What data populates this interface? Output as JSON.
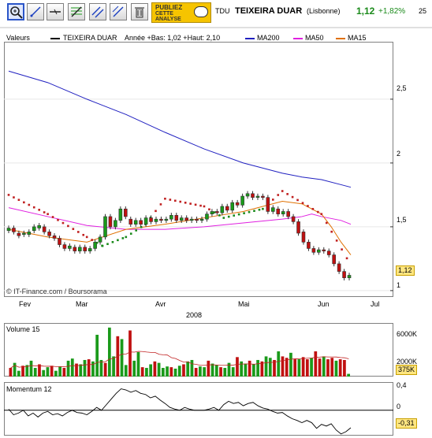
{
  "toolbar": {
    "tools": [
      "zoom-icon",
      "trendline-icon",
      "horizontal-line-icon",
      "fibonacci-icon",
      "channel-icon",
      "parallel-lines-icon",
      "trash-icon"
    ],
    "ad_line1": "PUBLIEZ",
    "ad_line2": "CETTE",
    "ad_line3": "ANALYSE",
    "symbol": "TDU",
    "name": "TEIXEIRA DUAR",
    "market": "(Lisbonne)",
    "price": "1,12",
    "change": "+1,82%",
    "count": "25",
    "price_color": "#1a8a1a"
  },
  "legend": {
    "label": "Valeurs",
    "series_name": "TEIXEIRA DUAR",
    "range_text": "Année +Bas: 1,02 +Haut: 2,10",
    "ma200": "MA200",
    "ma50": "MA50",
    "ma15": "MA15",
    "colors": {
      "ma200": "#2020c0",
      "ma50": "#e020e0",
      "ma15": "#e07000",
      "up": "#1a9a1a",
      "down": "#c01010",
      "sar_up": "#1a8a1a",
      "sar_down": "#c02020"
    }
  },
  "watermark": "© IT-Finance.com / Boursorama",
  "current_tag": "1,12",
  "x_axis": {
    "months": [
      "Fev",
      "Mar",
      "Avr",
      "Mai",
      "Jun",
      "Jul"
    ],
    "year": "2008"
  },
  "price_axis": {
    "ticks": [
      "2,5",
      "2",
      "1,5",
      "1"
    ]
  },
  "volume": {
    "label": "Volume 15",
    "ticks": [
      "6000K",
      "2000K"
    ],
    "tag": "375K"
  },
  "momentum": {
    "label": "Momentum 12",
    "ticks": [
      "0,4",
      "0"
    ],
    "tag": "-0,31"
  },
  "chart_data": [
    {
      "type": "candlestick",
      "title": "TEIXEIRA DUAR",
      "ylim": [
        0.95,
        2.95
      ],
      "x_range_days": [
        0,
        140
      ],
      "candles": [
        {
          "d": 0,
          "o": 1.47,
          "c": 1.49
        },
        {
          "d": 2,
          "o": 1.49,
          "c": 1.46
        },
        {
          "d": 4,
          "o": 1.45,
          "c": 1.43
        },
        {
          "d": 6,
          "o": 1.44,
          "c": 1.45
        },
        {
          "d": 8,
          "o": 1.44,
          "c": 1.46
        },
        {
          "d": 10,
          "o": 1.47,
          "c": 1.5
        },
        {
          "d": 12,
          "o": 1.49,
          "c": 1.51
        },
        {
          "d": 14,
          "o": 1.5,
          "c": 1.46
        },
        {
          "d": 16,
          "o": 1.46,
          "c": 1.43
        },
        {
          "d": 18,
          "o": 1.43,
          "c": 1.41
        },
        {
          "d": 20,
          "o": 1.41,
          "c": 1.36
        },
        {
          "d": 22,
          "o": 1.36,
          "c": 1.33
        },
        {
          "d": 24,
          "o": 1.33,
          "c": 1.35
        },
        {
          "d": 26,
          "o": 1.34,
          "c": 1.31
        },
        {
          "d": 28,
          "o": 1.31,
          "c": 1.34
        },
        {
          "d": 30,
          "o": 1.34,
          "c": 1.31
        },
        {
          "d": 32,
          "o": 1.31,
          "c": 1.33
        },
        {
          "d": 34,
          "o": 1.33,
          "c": 1.38
        },
        {
          "d": 36,
          "o": 1.38,
          "c": 1.42
        },
        {
          "d": 38,
          "o": 1.42,
          "c": 1.58
        },
        {
          "d": 40,
          "o": 1.58,
          "c": 1.5
        },
        {
          "d": 42,
          "o": 1.5,
          "c": 1.55
        },
        {
          "d": 44,
          "o": 1.55,
          "c": 1.64
        },
        {
          "d": 46,
          "o": 1.64,
          "c": 1.58
        },
        {
          "d": 48,
          "o": 1.56,
          "c": 1.52
        },
        {
          "d": 50,
          "o": 1.52,
          "c": 1.55
        },
        {
          "d": 52,
          "o": 1.55,
          "c": 1.52
        },
        {
          "d": 54,
          "o": 1.52,
          "c": 1.57
        },
        {
          "d": 56,
          "o": 1.57,
          "c": 1.54
        },
        {
          "d": 58,
          "o": 1.54,
          "c": 1.56
        },
        {
          "d": 60,
          "o": 1.56,
          "c": 1.55
        },
        {
          "d": 62,
          "o": 1.55,
          "c": 1.56
        },
        {
          "d": 64,
          "o": 1.56,
          "c": 1.59
        },
        {
          "d": 66,
          "o": 1.59,
          "c": 1.55
        },
        {
          "d": 68,
          "o": 1.55,
          "c": 1.57
        },
        {
          "d": 70,
          "o": 1.57,
          "c": 1.55
        },
        {
          "d": 72,
          "o": 1.55,
          "c": 1.56
        },
        {
          "d": 74,
          "o": 1.56,
          "c": 1.55
        },
        {
          "d": 76,
          "o": 1.55,
          "c": 1.56
        },
        {
          "d": 78,
          "o": 1.56,
          "c": 1.6
        },
        {
          "d": 80,
          "o": 1.6,
          "c": 1.62
        },
        {
          "d": 82,
          "o": 1.62,
          "c": 1.61
        },
        {
          "d": 84,
          "o": 1.61,
          "c": 1.66
        },
        {
          "d": 86,
          "o": 1.66,
          "c": 1.63
        },
        {
          "d": 88,
          "o": 1.63,
          "c": 1.69
        },
        {
          "d": 90,
          "o": 1.69,
          "c": 1.67
        },
        {
          "d": 92,
          "o": 1.67,
          "c": 1.74
        },
        {
          "d": 94,
          "o": 1.74,
          "c": 1.76
        },
        {
          "d": 96,
          "o": 1.76,
          "c": 1.73
        },
        {
          "d": 98,
          "o": 1.73,
          "c": 1.74
        },
        {
          "d": 100,
          "o": 1.74,
          "c": 1.73
        },
        {
          "d": 102,
          "o": 1.73,
          "c": 1.62
        },
        {
          "d": 104,
          "o": 1.62,
          "c": 1.65
        },
        {
          "d": 106,
          "o": 1.64,
          "c": 1.6
        },
        {
          "d": 108,
          "o": 1.6,
          "c": 1.62
        },
        {
          "d": 110,
          "o": 1.62,
          "c": 1.58
        },
        {
          "d": 112,
          "o": 1.58,
          "c": 1.54
        },
        {
          "d": 114,
          "o": 1.54,
          "c": 1.45
        },
        {
          "d": 116,
          "o": 1.46,
          "c": 1.38
        },
        {
          "d": 118,
          "o": 1.38,
          "c": 1.33
        },
        {
          "d": 120,
          "o": 1.33,
          "c": 1.3
        },
        {
          "d": 122,
          "o": 1.3,
          "c": 1.32
        },
        {
          "d": 124,
          "o": 1.32,
          "c": 1.31
        },
        {
          "d": 126,
          "o": 1.31,
          "c": 1.28
        },
        {
          "d": 128,
          "o": 1.28,
          "c": 1.21
        },
        {
          "d": 130,
          "o": 1.21,
          "c": 1.15
        },
        {
          "d": 132,
          "o": 1.15,
          "c": 1.1
        },
        {
          "d": 134,
          "o": 1.1,
          "c": 1.12
        }
      ],
      "series": [
        {
          "name": "MA200",
          "points": [
            [
              0,
              2.72
            ],
            [
              20,
              2.63
            ],
            [
              40,
              2.5
            ],
            [
              60,
              2.38
            ],
            [
              80,
              2.24
            ],
            [
              100,
              2.11
            ],
            [
              120,
              2.0
            ],
            [
              140,
              1.92
            ],
            [
              150,
              1.89
            ],
            [
              160,
              1.87
            ],
            [
              170,
              1.83
            ],
            [
              175,
              1.81
            ]
          ]
        },
        {
          "name": "MA50",
          "points": [
            [
              0,
              1.65
            ],
            [
              20,
              1.58
            ],
            [
              40,
              1.51
            ],
            [
              60,
              1.48
            ],
            [
              80,
              1.48
            ],
            [
              100,
              1.5
            ],
            [
              120,
              1.53
            ],
            [
              140,
              1.56
            ],
            [
              150,
              1.58
            ],
            [
              155,
              1.6
            ],
            [
              160,
              1.58
            ],
            [
              170,
              1.55
            ],
            [
              175,
              1.52
            ]
          ]
        },
        {
          "name": "MA15",
          "points": [
            [
              0,
              1.48
            ],
            [
              20,
              1.42
            ],
            [
              40,
              1.38
            ],
            [
              60,
              1.48
            ],
            [
              80,
              1.52
            ],
            [
              100,
              1.57
            ],
            [
              120,
              1.62
            ],
            [
              140,
              1.7
            ],
            [
              150,
              1.68
            ],
            [
              160,
              1.6
            ],
            [
              165,
              1.5
            ],
            [
              170,
              1.38
            ],
            [
              175,
              1.28
            ]
          ]
        }
      ],
      "sar": [
        {
          "d": 0,
          "v": 1.75,
          "dir": "down"
        },
        {
          "d": 20,
          "v": 1.6,
          "dir": "down"
        },
        {
          "d": 40,
          "v": 1.42,
          "dir": "down"
        },
        {
          "d": 48,
          "v": 1.35,
          "dir": "up"
        },
        {
          "d": 60,
          "v": 1.42,
          "dir": "up"
        },
        {
          "d": 70,
          "v": 1.52,
          "dir": "up"
        },
        {
          "d": 80,
          "v": 1.72,
          "dir": "down"
        },
        {
          "d": 100,
          "v": 1.66,
          "dir": "down"
        },
        {
          "d": 110,
          "v": 1.57,
          "dir": "up"
        },
        {
          "d": 130,
          "v": 1.64,
          "dir": "up"
        },
        {
          "d": 140,
          "v": 1.78,
          "dir": "down"
        },
        {
          "d": 160,
          "v": 1.6,
          "dir": "down"
        },
        {
          "d": 175,
          "v": 1.2,
          "dir": "down"
        }
      ]
    },
    {
      "type": "bar",
      "title": "Volume 15",
      "ylim": [
        0,
        7000
      ],
      "unit": "K",
      "values": [
        1200,
        1900,
        800,
        1500,
        1600,
        2200,
        1200,
        1700,
        900,
        1300,
        1500,
        800,
        1400,
        1200,
        2200,
        2500,
        1800,
        1700,
        2300,
        2400,
        2100,
        5800,
        2300,
        1900,
        6800,
        2800,
        5600,
        5200,
        1600,
        6400,
        2200,
        3400,
        1300,
        1200,
        1700,
        2100,
        1900,
        1200,
        1400,
        1300,
        1100,
        1500,
        1700,
        2100,
        2300,
        1200,
        1400,
        1300,
        2200,
        1800,
        1600,
        1300,
        1200,
        1900,
        1300,
        2700,
        2100,
        1800,
        2200,
        1700,
        2300,
        2100,
        2800,
        2600,
        2300,
        3500,
        2800,
        2600,
        3300,
        2400,
        2400,
        2700,
        2400,
        2600,
        3500,
        2500,
        2800,
        2400,
        2600,
        2200,
        2400,
        2300,
        375
      ],
      "down_flags": [
        1,
        0,
        0,
        1,
        0,
        0,
        0,
        1,
        0,
        0,
        1,
        0,
        0,
        1,
        0,
        0,
        1,
        0,
        0,
        1,
        0,
        0,
        0,
        1,
        0,
        0,
        1,
        0,
        0,
        1,
        0,
        0,
        1,
        0,
        0,
        1,
        0,
        0,
        0,
        1,
        0,
        0,
        1,
        0,
        0,
        1,
        0,
        0,
        1,
        0,
        0,
        1,
        0,
        0,
        0,
        1,
        0,
        0,
        1,
        0,
        0,
        1,
        0,
        0,
        1,
        0,
        1,
        1,
        0,
        1,
        0,
        1,
        1,
        0,
        1,
        1,
        0,
        1,
        1,
        0,
        1,
        1,
        0
      ]
    },
    {
      "type": "line",
      "title": "Momentum 12",
      "ylim": [
        -0.45,
        0.5
      ],
      "values": [
        0.02,
        -0.08,
        -0.05,
        0.0,
        -0.1,
        -0.05,
        -0.12,
        -0.05,
        -0.02,
        -0.08,
        -0.06,
        -0.1,
        -0.04,
        0.0,
        -0.04,
        -0.05,
        -0.08,
        -0.02,
        0.05,
        0.0,
        0.1,
        0.2,
        0.3,
        0.38,
        0.36,
        0.32,
        0.35,
        0.3,
        0.28,
        0.22,
        0.25,
        0.18,
        0.12,
        0.05,
        0.02,
        0.0,
        0.05,
        0.02,
        0.0,
        0.0,
        0.0,
        0.02,
        0.05,
        0.0,
        0.1,
        0.16,
        0.12,
        0.14,
        0.08,
        0.12,
        0.14,
        0.08,
        0.04,
        0.02,
        -0.02,
        -0.05,
        -0.04,
        -0.1,
        -0.15,
        -0.18,
        -0.22,
        -0.18,
        -0.22,
        -0.32,
        -0.25,
        -0.28,
        -0.24,
        -0.35,
        -0.42,
        -0.38,
        -0.31
      ]
    }
  ]
}
